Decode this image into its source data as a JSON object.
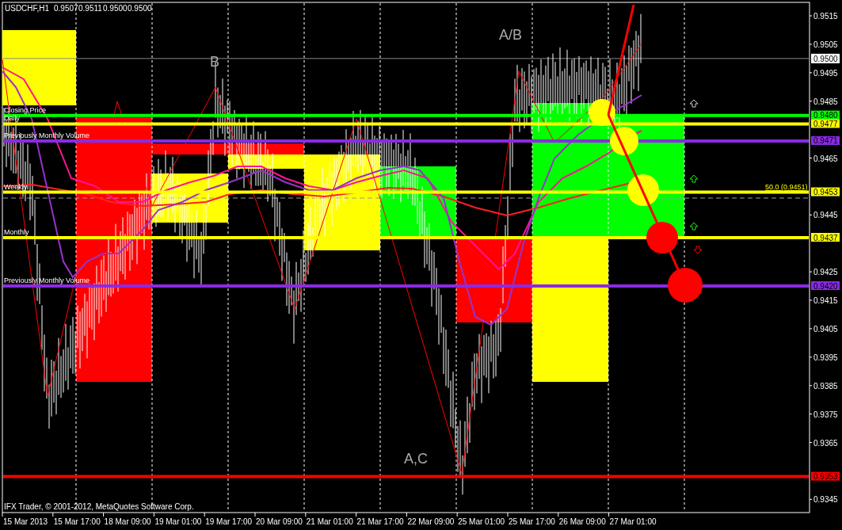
{
  "header": {
    "symbol": "USDCHF,H1",
    "ohlc": [
      "0.9507",
      "0.9511",
      "0.9500",
      "0.9500"
    ]
  },
  "price_axis": [
    "0.9515",
    "0.9505",
    "0.9495",
    "0.9485",
    "0.9465",
    "0.9445",
    "0.9425",
    "0.9415",
    "0.9405",
    "0.9395",
    "0.9385",
    "0.9375",
    "0.9365",
    "0.9345"
  ],
  "current_price": "0.9500",
  "levels": [
    {
      "label": "Closing Price",
      "price": "0.9480",
      "color": "#00ff00"
    },
    {
      "label": "Daily",
      "price": "0.9477",
      "color": "#ffff00"
    },
    {
      "label": "Previously Monthly Volume",
      "price": "0.9471",
      "color": "#8a2be2"
    },
    {
      "label": "Weekly",
      "price": "0.9453",
      "color": "#ffff00"
    },
    {
      "label": "Monthly",
      "price": "0.9437",
      "color": "#ffff00"
    },
    {
      "label": "Previously Monthly Volume",
      "price": "0.9420",
      "color": "#8a2be2"
    },
    {
      "price": "0.9353",
      "color": "#ff0000"
    }
  ],
  "fibo_label": "50.0 (0.9451)",
  "wave_labels": [
    {
      "text": "B"
    },
    {
      "text": "A/B"
    },
    {
      "text": "A,C"
    }
  ],
  "copyright": "IFX Trader, © 2001-2012, MetaQuotes Software Corp.",
  "time_axis": [
    "15 Mar 2013",
    "15 Mar 17:00",
    "18 Mar 09:00",
    "19 Mar 01:00",
    "19 Mar 17:00",
    "20 Mar 09:00",
    "21 Mar 01:00",
    "21 Mar 17:00",
    "22 Mar 09:00",
    "25 Mar 01:00",
    "25 Mar 17:00",
    "26 Mar 09:00",
    "27 Mar 01:00"
  ]
}
